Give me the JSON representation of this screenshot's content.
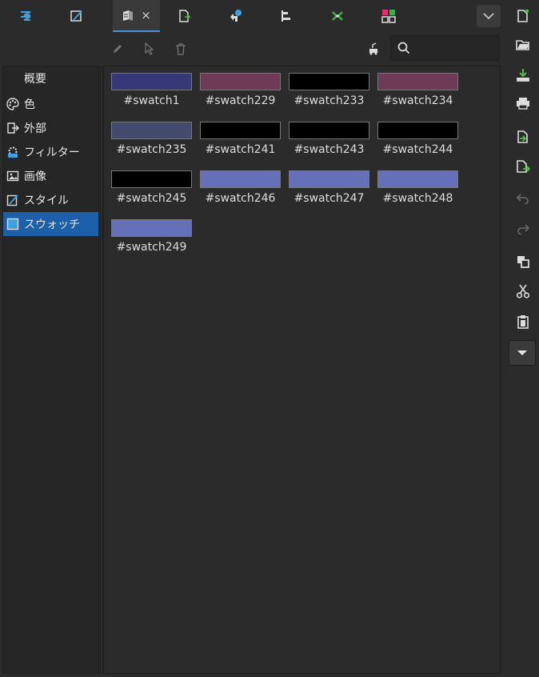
{
  "tabs": [
    {
      "name": "fill-and-stroke"
    },
    {
      "name": "brush"
    },
    {
      "name": "swatches",
      "close": "×"
    },
    {
      "name": "export"
    },
    {
      "name": "undo-history"
    },
    {
      "name": "align"
    },
    {
      "name": "symbols"
    },
    {
      "name": "patterns"
    }
  ],
  "categories": [
    {
      "label": "概要"
    },
    {
      "label": "色"
    },
    {
      "label": "外部"
    },
    {
      "label": "フィルター"
    },
    {
      "label": "画像"
    },
    {
      "label": "スタイル"
    },
    {
      "label": "スウォッチ",
      "selected": true
    }
  ],
  "swatches": [
    {
      "label": "#swatch1",
      "color": "#363877"
    },
    {
      "label": "#swatch229",
      "color": "#6e3a55"
    },
    {
      "label": "#swatch233",
      "color": "#000000"
    },
    {
      "label": "#swatch234",
      "color": "#6e3a55"
    },
    {
      "label": "#swatch235",
      "color": "#444a6e"
    },
    {
      "label": "#swatch241",
      "color": "#000000"
    },
    {
      "label": "#swatch243",
      "color": "#000000"
    },
    {
      "label": "#swatch244",
      "color": "#000000"
    },
    {
      "label": "#swatch245",
      "color": "#000000"
    },
    {
      "label": "#swatch246",
      "color": "#6470b8"
    },
    {
      "label": "#swatch247",
      "color": "#6470b8"
    },
    {
      "label": "#swatch248",
      "color": "#6470b8"
    },
    {
      "label": "#swatch249",
      "color": "#6470b8"
    }
  ],
  "search": {
    "placeholder": "",
    "value": ""
  },
  "colors": {
    "accent": "#4a90d9",
    "selection": "#1d5fa8"
  }
}
